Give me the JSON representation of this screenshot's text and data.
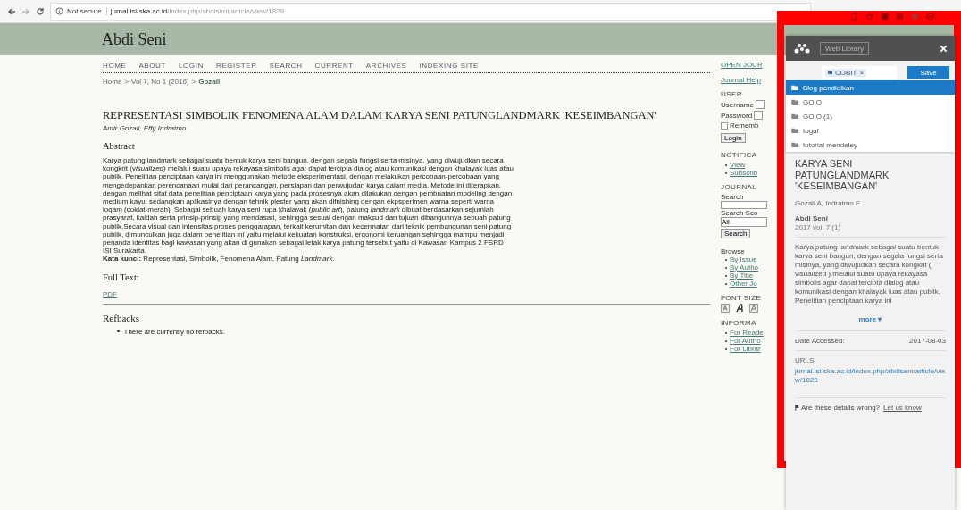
{
  "browser": {
    "security": "Not secure",
    "url_host": "jurnal.isi-ska.ac.id",
    "url_path": "/index.php/abdiseni/article/view/1829"
  },
  "site": {
    "title": "Abdi Seni",
    "nav": [
      "HOME",
      "ABOUT",
      "LOGIN",
      "REGISTER",
      "SEARCH",
      "CURRENT",
      "ARCHIVES",
      "INDEXING SITE"
    ],
    "breadcrumb": {
      "home": "Home",
      "separator": ">",
      "issue": "Vol 7, No 1 (2016)",
      "current": "Gozali"
    }
  },
  "article": {
    "title": "REPRESENTASI SIMBOLIK FENOMENA ALAM DALAM KARYA SENI PATUNGLANDMARK 'KESEIMBANGAN'",
    "authors": "Amir Gozali, Effy Indratmo",
    "abstract_heading": "Abstract",
    "abstract": "Karya patung landmark sebagai suatu bentuk karya seni bangun, dengan segala fungsi serta misinya, yang diwujudkan secara kongkrit (*visualized*) melalui suatu upaya rekayasa simbolis agar dapat tercipta dialog atau komunikasi dengan khalayak luas atau publik. Penelitian penciptaan karya ini menggunakan metode eksperimentasi, dengan melakukan percobaan-percobaan yang mengedepankan perencanaan mulai dari perancangan, persiapan dan perwujudan karya dalam media. Metode ini diterapkan, dengan melihat sifat data penelitian penciptaan karya yang pada prosesnya akan dilakukan dengan pembuatan modeling dengan medium kayu, sedangkan aplikasinya dengan tehnik plester yang akan difnishing dengan ekpsperimen warna seperti warna logam (coklat-merah). Sebagai sebuah karya seni rupa khalayak (*public art*), patung *landmark* dibuat berdasarkan sejumlah prasyarat, kaidah serta prinsip-prinsip yang mendasari, sehingga sesuai dengan maksud dan tujuan dibangunnya sebuah patung publik.Secara visual dan intensitas proses penggarapan, terkait kerumitan dan kecermatan dari teknik pembangunan seni patung publik, dimunculkan juga dalam penelitian ini yaitu melalui kekuatan konstruksi, ergonomi keruangan sehingga mampu menjadi penanda identitas bagi kawasan yang akan di gunakan sebagai letak karya patung tersebut yaitu di Kawasan Kampus 2 FSRD ISI Surakarta.",
    "keywords": "**Kata kunci:** Representasi, Simbolik, Fenomena Alam, Patung *Landmark*.",
    "full_text_heading": "Full Text:",
    "pdf_link": "PDF",
    "refbacks_heading": "Refbacks",
    "refbacks": [
      "There are currently no refbacks."
    ]
  },
  "sidebar": {
    "top_link": "OPEN JOUR",
    "help_link": "Journal Help",
    "user": {
      "heading": "USER",
      "username_label": "Username",
      "password_label": "Password",
      "remember_label": "Rememb",
      "remember_checked": false,
      "login_button": "Login"
    },
    "notifications": {
      "heading": "NOTIFICA",
      "links": [
        "View",
        "Subscrib"
      ]
    },
    "journal_content": {
      "heading": "JOURNAL",
      "search_label": "Search",
      "scope_label": "Search Sco",
      "scope_value": "All",
      "search_button": "Search",
      "browse_label": "Browse",
      "browse_links": [
        "By Issue",
        "By Autho",
        "By Title",
        "Other Jo"
      ]
    },
    "font_size": {
      "heading": "FONT SIZE"
    },
    "information": {
      "heading": "INFORMA",
      "links": [
        "For Reade",
        "For Autho",
        "For Librar"
      ]
    }
  },
  "mendeley": {
    "web_library_button": "Web Library",
    "tag": {
      "label": "COBIT",
      "remove": "×"
    },
    "save_button": "Save",
    "folders": [
      {
        "name": "Blog pendidikan",
        "selected": true
      },
      {
        "name": "GOIO",
        "selected": false
      },
      {
        "name": "GOIO (1)",
        "selected": false
      },
      {
        "name": "togaf",
        "selected": false
      },
      {
        "name": "tutorial mendeley",
        "selected": false
      }
    ],
    "title": "KARYA SENI PATUNGLANDMARK 'KESEIMBANGAN'",
    "authors": "Gozali A,  Indratmo E",
    "journal": "Abdi Seni",
    "issue": "2017 vol. 7 (1)",
    "abstract": "Karya patung landmark sebagai suatu bentuk karya seni bangun, dengan segala fungsi serta misinya, yang diwujudkan secara kongkrit ( visualized ) melalui suatu upaya rekayasa simbolis agar dapat tercipta dialog atau komunikasi dengan khalayak luas atau publik. Penelitian penciptaan karya ini",
    "more_link": "more ▾",
    "date_label": "Date Accessed:",
    "date_value": "2017-08-03",
    "urls_label": "URLS",
    "url": "jurnal.isi-ska.ac.id/index.php/abdiseni/article/view/1829",
    "feedback": "Are these details wrong?",
    "feedback_link": "Let us know"
  }
}
